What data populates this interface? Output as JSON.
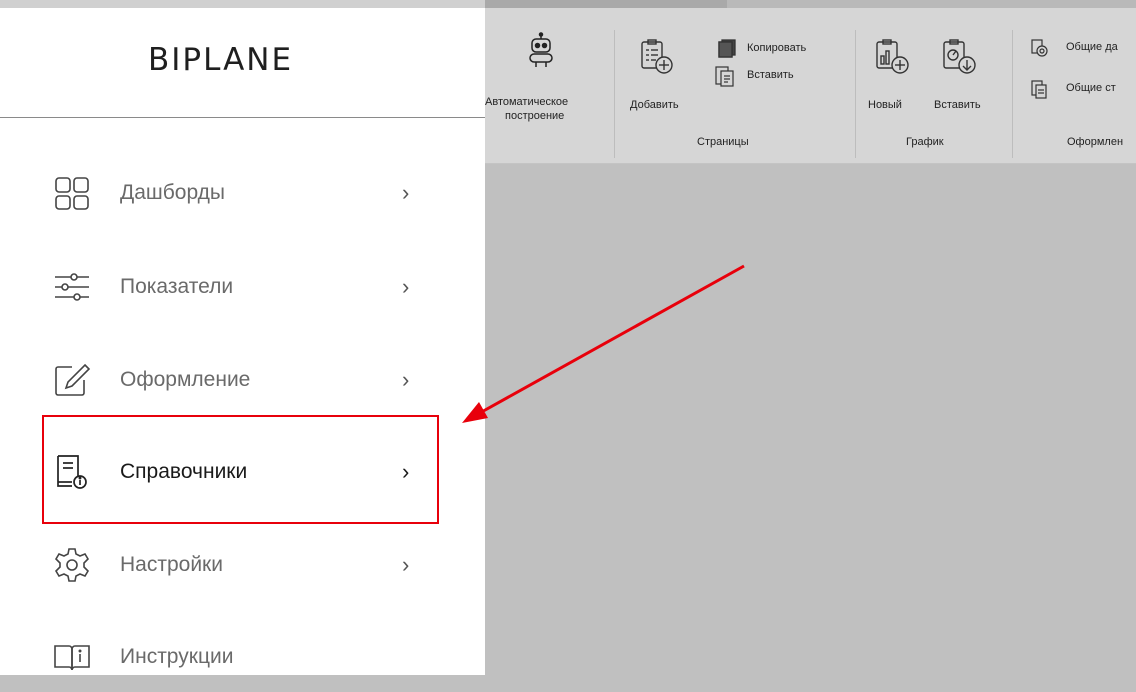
{
  "sidebar": {
    "logo": "BIPLANE",
    "items": [
      {
        "label": "Дашборды",
        "icon": "dashboard-grid-icon",
        "chevron": "›"
      },
      {
        "label": "Показатели",
        "icon": "sliders-icon",
        "chevron": "›"
      },
      {
        "label": "Оформление",
        "icon": "edit-square-icon",
        "chevron": "›"
      },
      {
        "label": "Справочники",
        "icon": "reference-book-icon",
        "chevron": "›",
        "active": true
      },
      {
        "label": "Настройки",
        "icon": "gear-icon",
        "chevron": "›"
      },
      {
        "label": "Инструкции",
        "icon": "book-info-icon"
      }
    ]
  },
  "ribbon": {
    "auto_build": {
      "line1": "Автоматическое",
      "line2": "построение"
    },
    "pages": {
      "add": "Добавить",
      "copy": "Копировать",
      "paste": "Вставить",
      "group": "Страницы"
    },
    "chart": {
      "new": "Новый",
      "paste": "Вставить",
      "group": "График"
    },
    "design": {
      "common_data": "Общие да",
      "common_styles": "Общие ст",
      "group": "Оформлен"
    }
  },
  "annotation": {
    "highlight_color": "#e8000b"
  }
}
